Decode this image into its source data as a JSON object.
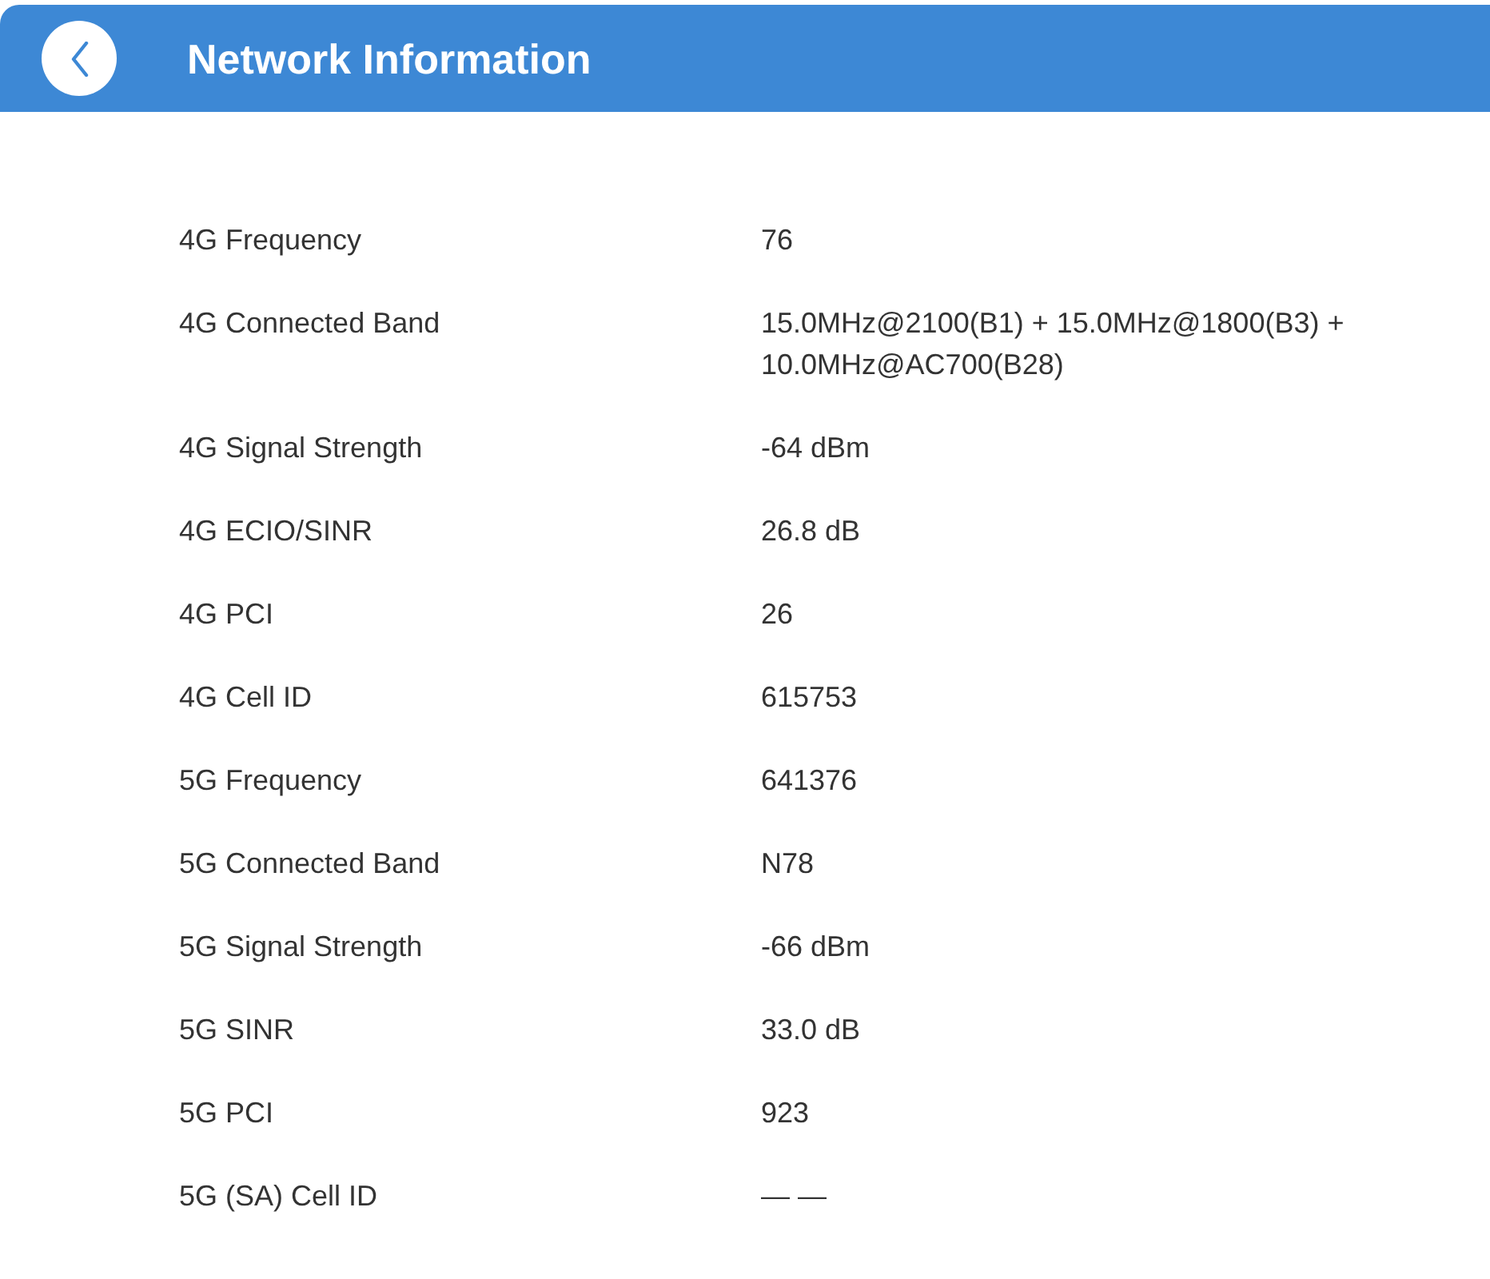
{
  "header": {
    "title": "Network Information"
  },
  "rows": [
    {
      "label": "4G Frequency",
      "value": "76"
    },
    {
      "label": "4G Connected Band",
      "value": "15.0MHz@2100(B1) + 15.0MHz@1800(B3) + 10.0MHz@AC700(B28)"
    },
    {
      "label": "4G Signal Strength",
      "value": "-64 dBm"
    },
    {
      "label": "4G ECIO/SINR",
      "value": "26.8 dB"
    },
    {
      "label": "4G PCI",
      "value": "26"
    },
    {
      "label": "4G Cell ID",
      "value": "615753"
    },
    {
      "label": "5G Frequency",
      "value": "641376"
    },
    {
      "label": "5G Connected Band",
      "value": "N78"
    },
    {
      "label": "5G Signal Strength",
      "value": "-66 dBm"
    },
    {
      "label": "5G SINR",
      "value": "33.0 dB"
    },
    {
      "label": "5G PCI",
      "value": "923"
    },
    {
      "label": "5G (SA) Cell ID",
      "value": "— —"
    }
  ]
}
